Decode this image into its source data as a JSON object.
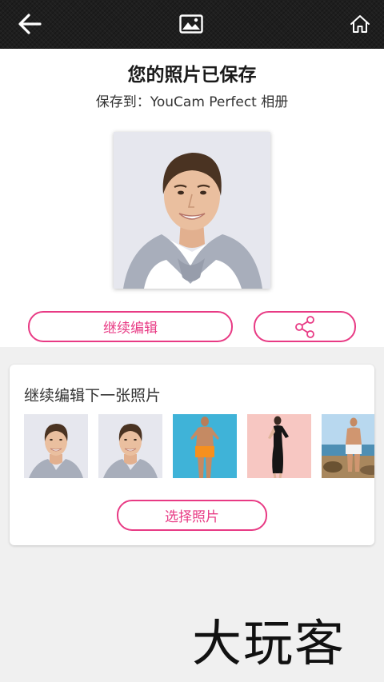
{
  "toolbar": {
    "back_icon": "arrow-left-icon",
    "gallery_icon": "image-icon",
    "home_icon": "home-icon"
  },
  "saved": {
    "title": "您的照片已保存",
    "subtitle": "保存到：YouCam Perfect 相册",
    "continue_label": "继续编辑",
    "share_icon": "share-icon"
  },
  "next": {
    "title": "继续编辑下一张照片",
    "thumbnails": [
      "portrait-man-smiling",
      "portrait-man-smiling",
      "man-orange-shorts",
      "woman-black-dress",
      "man-beach"
    ],
    "select_label": "选择照片"
  },
  "watermark": {
    "text": "大玩客"
  },
  "colors": {
    "accent": "#e83a84",
    "topbar": "#1e1e1e",
    "background": "#f0f0f0"
  }
}
